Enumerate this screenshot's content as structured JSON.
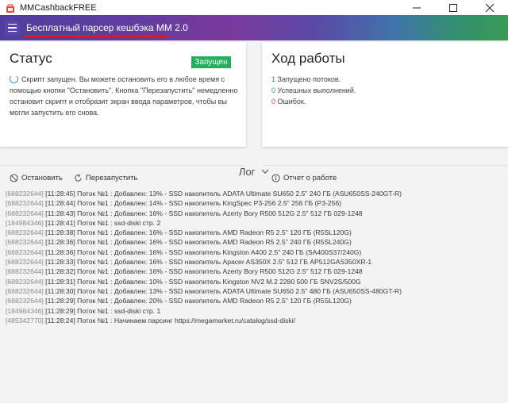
{
  "window": {
    "title": "MMCashbackFREE"
  },
  "appbar": {
    "heading": "Бесплатный парсер кешбэка ММ 2.0"
  },
  "status_card": {
    "title": "Статус",
    "badge": "Запущен",
    "message": "Скрипт запущен. Вы можете остановить его в любое время с помощью кнопки \"Остановить\". Кнопка \"Перезапустить\" немедленно остановит скрипт и отобразит экран ввода параметров, чтобы вы могли запустить его снова.",
    "stop_label": "Остановить",
    "restart_label": "Перезапустить"
  },
  "progress_card": {
    "title": "Ход работы",
    "threads_count": "1",
    "threads_label": " Запущено потоков.",
    "success_count": "0",
    "success_label": " Успешных выполнений.",
    "errors_count": "0",
    "errors_label": " Ошибок.",
    "report_label": "Отчет о работе"
  },
  "log": {
    "title": "Лог",
    "entries": [
      {
        "id": "[688232644]",
        "text": " [11:28:45] Поток №1 : Добавлен: 13% - SSD накопитель ADATA Ultimate SU650 2.5\" 240 ГБ (ASU650SS-240GT-R)"
      },
      {
        "id": "[688232644]",
        "text": " [11:28:44] Поток №1 : Добавлен: 14% - SSD накопитель KingSpec P3-256 2.5\" 256 ГБ (P3-256)"
      },
      {
        "id": "[688232644]",
        "text": " [11:28:43] Поток №1 : Добавлен: 16% - SSD накопитель Azerty Bory R500 512G 2.5\" 512 ГБ 029-1248"
      },
      {
        "id": "[184984346]",
        "text": " [11:28:41] Поток №1 : ssd-diski стр. 2"
      },
      {
        "id": "[688232644]",
        "text": " [11:28:38] Поток №1 : Добавлен: 16% - SSD накопитель AMD Radeon R5 2.5\" 120 ГБ (R5SL120G)"
      },
      {
        "id": "[688232644]",
        "text": " [11:28:36] Поток №1 : Добавлен: 16% - SSD накопитель AMD Radeon R5 2.5\" 240 ГБ (R5SL240G)"
      },
      {
        "id": "[688232644]",
        "text": " [11:28:36] Поток №1 : Добавлен: 16% - SSD накопитель Kingston A400 2.5\" 240 ГБ (SA400S37/240G)"
      },
      {
        "id": "[688232644]",
        "text": " [11:28:33] Поток №1 : Добавлен: 16% - SSD накопитель Apacer AS350X 2.5\" 512 ГБ AP512GAS350XR-1"
      },
      {
        "id": "[688232644]",
        "text": " [11:28:32] Поток №1 : Добавлен: 16% - SSD накопитель Azerty Bory R500 512G 2.5\" 512 ГБ 029-1248"
      },
      {
        "id": "[688232644]",
        "text": " [11:28:31] Поток №1 : Добавлен: 10% - SSD накопитель Kingston NV2 M.2 2280 500 ГБ SNV2S/500G"
      },
      {
        "id": "[688232644]",
        "text": " [11:28:30] Поток №1 : Добавлен: 13% - SSD накопитель ADATA Ultimate SU650 2.5\" 480 ГБ (ASU650SS-480GT-R)"
      },
      {
        "id": "[688232644]",
        "text": " [11:28:29] Поток №1 : Добавлен: 20% - SSD накопитель AMD Radeon R5 2.5\" 120 ГБ (R5SL120G)"
      },
      {
        "id": "[184984346]",
        "text": " [11:28:29] Поток №1 : ssd-diski стр. 1"
      },
      {
        "id": "[485342770]",
        "text": " [11:28:24] Поток №1 : Начинаем парсинг https://megamarket.ru/catalog/ssd-diski/"
      }
    ]
  },
  "colors": {
    "accent_red": "#e0191e",
    "badge_green": "#21b05b",
    "threads_blue": "#2b86d9",
    "success_green": "#20a85a",
    "error_red": "#e0463a"
  },
  "icons": [
    "app-icon",
    "menu-icon",
    "minimize-icon",
    "maximize-icon",
    "close-icon",
    "spinner-icon",
    "stop-icon",
    "restart-icon",
    "info-icon",
    "chevron-down-icon"
  ]
}
